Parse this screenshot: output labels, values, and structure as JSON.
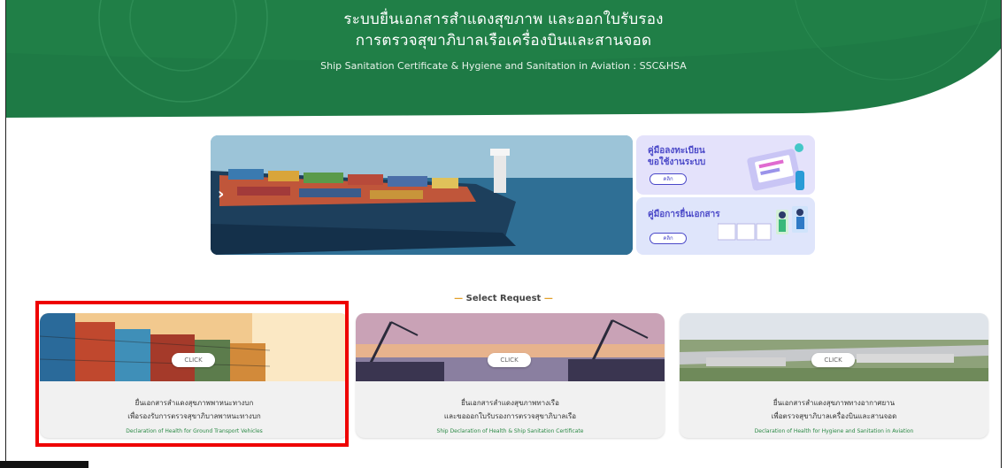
{
  "header": {
    "title_th_line1": "ระบบยื่นเอกสารสำแดงสุขภาพ และออกใบรับรอง",
    "title_th_line2": "การตรวจสุขาภิบาลเรือเครื่องบินและสานจอด",
    "title_en": "Ship Sanitation Certificate & Hygiene and Sanitation in Aviation : SSC&HSA"
  },
  "banner": {
    "next_icon": "chevron-right-icon"
  },
  "manuals": [
    {
      "line1": "คู่มือลงทะเบียน",
      "line2": "ขอใช้งานระบบ",
      "button": "คลิก",
      "icon": "clipboard-illustration-icon"
    },
    {
      "line1": "คู่มือการยื่นเอกสาร",
      "line2": "",
      "button": "คลิก",
      "icon": "documents-illustration-icon"
    }
  ],
  "select_request": {
    "title": "Select Request",
    "dash": "—"
  },
  "cards": [
    {
      "click": "CLICK",
      "line1": "ยื่นเอกสารสำแดงสุขภาพพาหนะทางบก",
      "line2": "เพื่อรองรับการตรวจสุขาภิบาลพาหนะทางบก",
      "line3": "Declaration of Health for Ground Transport Vehicles"
    },
    {
      "click": "CLICK",
      "line1": "ยื่นเอกสารสำแดงสุขภาพทางเรือ",
      "line2": "และขอออกใบรับรองการตรวจสุขาภิบาลเรือ",
      "line3": "Ship Declaration of Health & Ship Sanitation Certificate"
    },
    {
      "click": "CLICK",
      "line1": "ยื่นเอกสารสำแดงสุขภาพทางอากาศยาน",
      "line2": "เพื่อตรวจสุขาภิบาลเครื่องบินและสานจอด",
      "line3": "Declaration of Health for Hygiene and Sanitation in Aviation"
    }
  ],
  "colors": {
    "header_green": "#1e7a45",
    "highlight_red": "#ee0000",
    "manual_purple": "#4a48c8",
    "card_subtitle_green": "#2c8a46"
  }
}
